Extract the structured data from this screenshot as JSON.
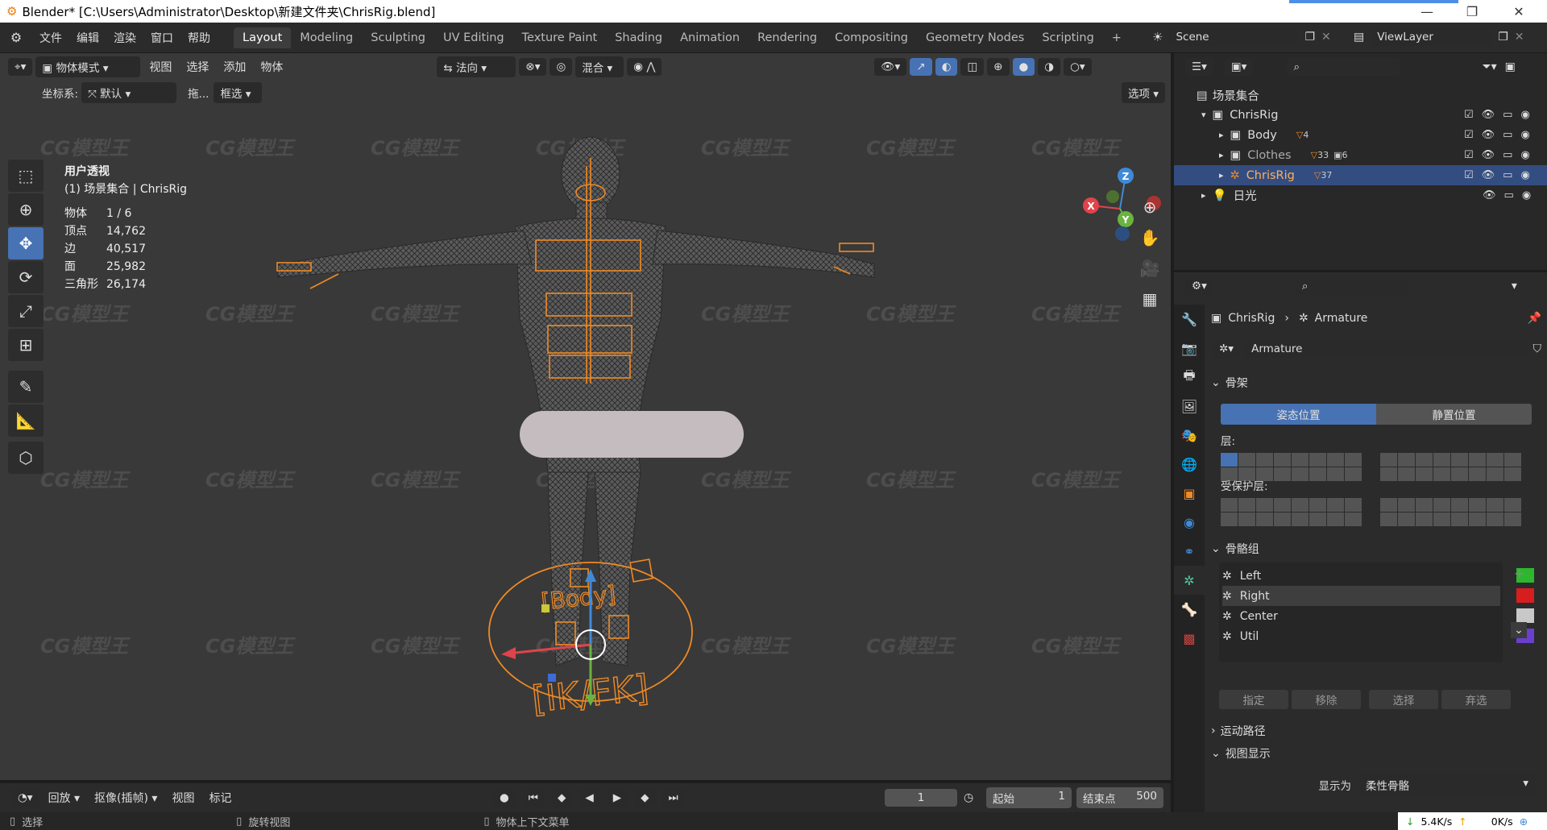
{
  "window": {
    "title": "Blender* [C:\\Users\\Administrator\\Desktop\\新建文件夹\\ChrisRig.blend]",
    "min": "—",
    "max": "❐",
    "close": "✕"
  },
  "menus": [
    "文件",
    "编辑",
    "渲染",
    "窗口",
    "帮助"
  ],
  "workspaces": [
    "Layout",
    "Modeling",
    "Sculpting",
    "UV Editing",
    "Texture Paint",
    "Shading",
    "Animation",
    "Rendering",
    "Compositing",
    "Geometry Nodes",
    "Scripting"
  ],
  "add_tab": "+",
  "scene": {
    "label": "Scene",
    "view_layer": "ViewLayer"
  },
  "viewport": {
    "mode": "物体模式",
    "menus": [
      "视图",
      "选择",
      "添加",
      "物体"
    ],
    "orientation": "法向",
    "pivot": "混合",
    "coord_label": "坐标系:",
    "coord_value": "默认",
    "drag_label": "拖...",
    "drag_value": "框选",
    "options": "选项",
    "view_name": "用户透视",
    "collection_info": "(1) 场景集合 | ChrisRig",
    "stats": [
      [
        "物体",
        "1 / 6"
      ],
      [
        "顶点",
        "14,762"
      ],
      [
        "边",
        "40,517"
      ],
      [
        "面",
        "25,982"
      ],
      [
        "三角形",
        "26,174"
      ]
    ],
    "rig_label_body": "[Body]",
    "rig_label_ikfk": "[IK/FK]",
    "gizmo": {
      "x": "X",
      "y": "Y",
      "z": "Z"
    }
  },
  "timeline": {
    "play_label": "回放",
    "keying_label": "抠像(插帧)",
    "menus": [
      "视图",
      "标记"
    ],
    "current_frame": "1",
    "start_label": "起始",
    "start_value": "1",
    "end_label": "结束点",
    "end_value": "500"
  },
  "status": {
    "select": "选择",
    "rotate": "旋转视图",
    "context": "物体上下文菜单",
    "down_speed": "5.4K/s",
    "up_speed": "0K/s"
  },
  "outliner": {
    "root": "场景集合",
    "items": [
      {
        "name": "ChrisRig",
        "indent": 1
      },
      {
        "name": "Body",
        "indent": 2,
        "count": "4"
      },
      {
        "name": "Clothes",
        "indent": 2,
        "count": "33",
        "count2": "6"
      },
      {
        "name": "ChrisRig",
        "indent": 2,
        "count": "37",
        "selected": true
      },
      {
        "name": "日光",
        "indent": 1
      }
    ]
  },
  "properties": {
    "breadcrumb_obj": "ChrisRig",
    "breadcrumb_data": "Armature",
    "data_name": "Armature",
    "skeleton_panel": "骨架",
    "pose_position": "姿态位置",
    "rest_position": "静置位置",
    "layers_label": "层:",
    "protected_layers_label": "受保护层:",
    "bone_groups_panel": "骨骼组",
    "bone_groups": [
      {
        "name": "Left",
        "color": "#2fb62f"
      },
      {
        "name": "Right",
        "color": "#d61e1e"
      },
      {
        "name": "Center",
        "color": "#c8c8c8"
      },
      {
        "name": "Util",
        "color": "#6a3fcf"
      }
    ],
    "buttons": [
      "指定",
      "移除",
      "选择",
      "弃选"
    ],
    "motion_paths": "运动路径",
    "viewport_display": "视图显示",
    "display_as_label": "显示为",
    "display_as_value": "柔性骨骼"
  },
  "watermark": "CG模型王",
  "colors": {
    "accent": "#4772b3",
    "selection_orange": "#f08a24"
  }
}
